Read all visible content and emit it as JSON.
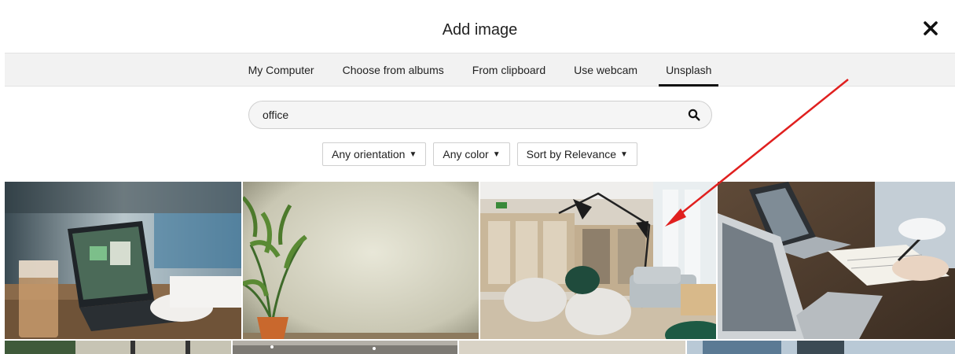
{
  "modal": {
    "title": "Add image",
    "close_label": "close"
  },
  "tabs": [
    {
      "label": "My Computer",
      "active": false
    },
    {
      "label": "Choose from albums",
      "active": false
    },
    {
      "label": "From clipboard",
      "active": false
    },
    {
      "label": "Use webcam",
      "active": false
    },
    {
      "label": "Unsplash",
      "active": true
    }
  ],
  "search": {
    "value": "office",
    "icon": "search-icon"
  },
  "filters": {
    "orientation": "Any orientation",
    "color": "Any color",
    "sort": "Sort by Relevance"
  },
  "photos": [
    {
      "subject": "laptop-coffee-cafe"
    },
    {
      "subject": "plant-against-wall"
    },
    {
      "subject": "office-lounge-lamp"
    },
    {
      "subject": "hands-laptop-notes"
    },
    {
      "subject": "office-partial-1"
    },
    {
      "subject": "office-partial-2"
    },
    {
      "subject": "office-partial-3"
    },
    {
      "subject": "office-partial-4"
    }
  ],
  "annotation": {
    "arrow_color": "#e0201f"
  },
  "colors": {
    "tab_bar_bg": "#f2f2f2",
    "active_tab_underline": "#111111"
  }
}
